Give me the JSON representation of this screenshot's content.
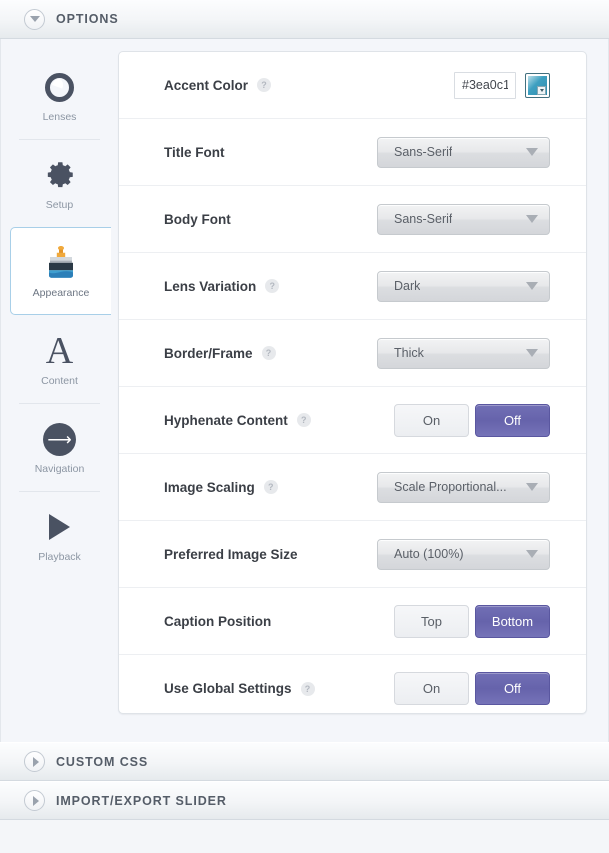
{
  "sections": {
    "options": {
      "title": "OPTIONS",
      "expanded": true,
      "toggle_icon": "chevron-down-icon"
    },
    "custom_css": {
      "title": "CUSTOM CSS",
      "expanded": false,
      "toggle_icon": "chevron-right-icon"
    },
    "import_export": {
      "title": "IMPORT/EXPORT SLIDER",
      "expanded": false,
      "toggle_icon": "chevron-right-icon"
    }
  },
  "sidebar": {
    "items": [
      {
        "label": "Lenses",
        "icon": "lens-ring-icon",
        "active": false
      },
      {
        "label": "Setup",
        "icon": "gear-icon",
        "active": false
      },
      {
        "label": "Appearance",
        "icon": "paintbrush-icon",
        "active": true
      },
      {
        "label": "Content",
        "icon": "letter-a-icon",
        "active": false
      },
      {
        "label": "Navigation",
        "icon": "arrow-right-circle-icon",
        "active": false
      },
      {
        "label": "Playback",
        "icon": "play-triangle-icon",
        "active": false
      }
    ]
  },
  "accent_color_hex": "#3ea0c1",
  "active_toggle_color": "#6663ab",
  "rows": [
    {
      "label": "Accent Color",
      "help": true,
      "control": "color",
      "value": "#3ea0c1",
      "placeholder": "#000000",
      "swatch_name": "color-swatch-button"
    },
    {
      "label": "Title Font",
      "help": false,
      "control": "select",
      "value": "Sans-Serif"
    },
    {
      "label": "Body Font",
      "help": false,
      "control": "select",
      "value": "Sans-Serif"
    },
    {
      "label": "Lens Variation",
      "help": true,
      "control": "select",
      "value": "Dark"
    },
    {
      "label": "Border/Frame",
      "help": true,
      "control": "select",
      "value": "Thick"
    },
    {
      "label": "Hyphenate Content",
      "help": true,
      "control": "toggle",
      "options": [
        "On",
        "Off"
      ],
      "selected": "Off"
    },
    {
      "label": "Image Scaling",
      "help": true,
      "control": "select",
      "value": "Scale Proportional..."
    },
    {
      "label": "Preferred Image Size",
      "help": false,
      "control": "select",
      "value": "Auto (100%)",
      "wide": true
    },
    {
      "label": "Caption Position",
      "help": false,
      "control": "toggle",
      "options": [
        "Top",
        "Bottom"
      ],
      "selected": "Bottom"
    },
    {
      "label": "Use Global Settings",
      "help": true,
      "control": "toggle",
      "options": [
        "On",
        "Off"
      ],
      "selected": "Off"
    }
  ],
  "help_glyph": "?"
}
